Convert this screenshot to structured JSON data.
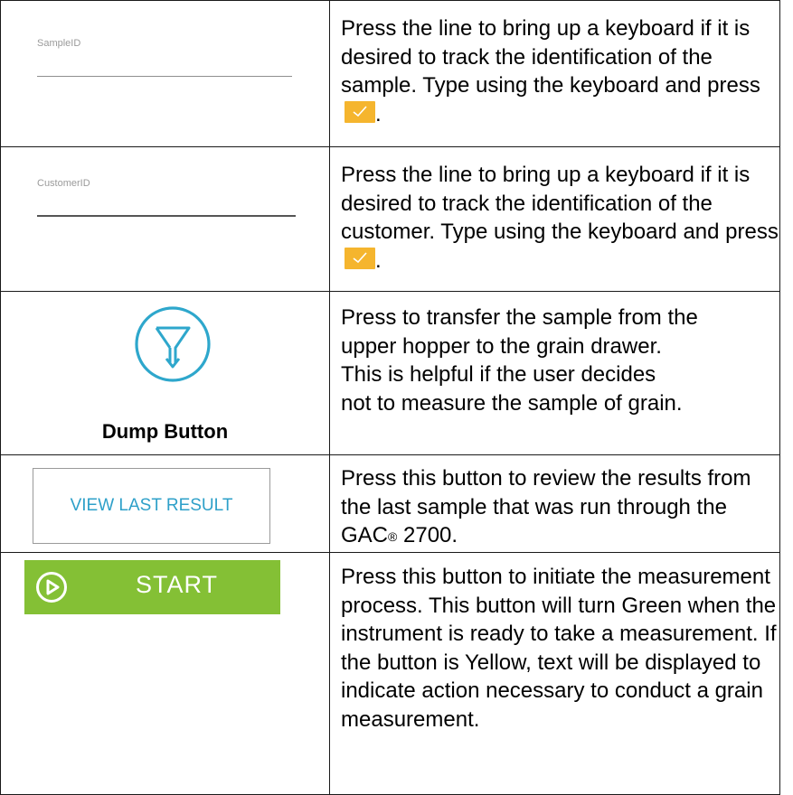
{
  "rows": [
    {
      "field_label": "SampleID",
      "text_before": "Press the line to bring up a keyboard if it is desired to track the identification of the sample. Type using the keyboard and press",
      "text_after": ".",
      "icon": "checkmark-icon"
    },
    {
      "field_label": "CustomerID",
      "text_before": "Press the line to bring up a keyboard if it is desired to track the identification of the customer. Type using the keyboard and press",
      "text_after": ".",
      "icon": "checkmark-icon"
    },
    {
      "label": "Dump Button",
      "icon": "funnel-dump-icon",
      "lines": [
        "Press to transfer the sample from the",
        "upper hopper to the grain drawer.",
        "This is helpful if the user decides",
        "not to measure the sample of grain."
      ]
    },
    {
      "button_label": "VIEW LAST RESULT",
      "text_before": "Press this button to review the results from the last sample that was run through the GAC",
      "registered": "®",
      "text_after": " 2700."
    },
    {
      "button_label": "START",
      "icon": "play-circle-icon",
      "text": "Press this button to initiate the measurement process. This button will turn Green when the instrument is ready to take a measurement. If the button is Yellow, text will be displayed to indicate action necessary to conduct a grain measurement."
    }
  ],
  "colors": {
    "check_button": "#f5b52e",
    "start_button": "#84c035",
    "view_button_text": "#2ea0c9",
    "dump_icon": "#2ea7cc"
  }
}
